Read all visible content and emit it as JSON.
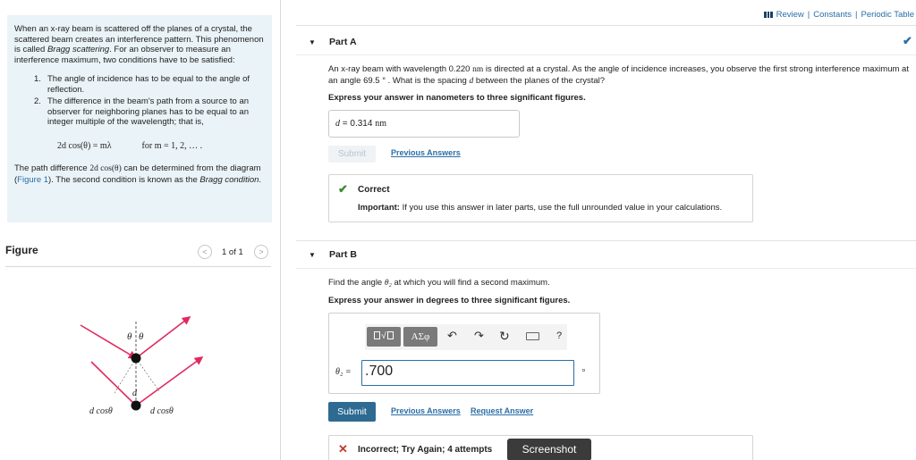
{
  "intro": {
    "para1_before": "When an x-ray beam is scattered off the planes of a crystal, the scattered beam creates an interference pattern. This phenomenon is called ",
    "para1_term": "Bragg scattering",
    "para1_after": ". For an observer to measure an interference maximum, two conditions have to be satisfied:",
    "conditions": [
      {
        "num": "1.",
        "text": "The angle of incidence has to be equal to the angle of reflection."
      },
      {
        "num": "2.",
        "text": "The difference in the beam's path from a source to an observer for neighboring planes has to be equal to an integer multiple of the wavelength; that is,"
      }
    ],
    "equation": "2d cos(θ) = mλ",
    "equation_condition": "for m = 1, 2, … .",
    "path_before": "The path difference ",
    "path_expr": "2d cos(θ)",
    "path_mid": " can be determined from the diagram (",
    "path_link": "Figure 1",
    "path_after": "). The second condition is known as the ",
    "path_term": "Bragg condition",
    "path_end": "."
  },
  "figure": {
    "title": "Figure",
    "pager_text": "1 of 1",
    "prev_glyph": "<",
    "next_glyph": ">",
    "labels": {
      "theta1": "θ",
      "theta2": "θ",
      "d": "d",
      "dcos_left": "d cosθ",
      "dcos_right": "d cosθ"
    },
    "ray_color": "#e0295f"
  },
  "header": {
    "review": "Review",
    "constants": "Constants",
    "periodic": "Periodic Table",
    "separator": "|"
  },
  "partA": {
    "toggle": "▼",
    "title": "Part A",
    "check": "✔",
    "question_before": "An x-ray beam with wavelength 0.220 ",
    "question_unit": "nm",
    "question_mid": " is directed at a crystal. As the angle of incidence increases, you observe the first strong interference maximum at an angle 69.5 ° . What is the spacing ",
    "question_var": "d",
    "question_after": " between the planes of the crystal?",
    "instruction": "Express your answer in nanometers to three significant figures.",
    "answer_var": "d",
    "answer_eq": " = ",
    "answer_value": "0.314",
    "answer_unit": "nm",
    "submit_label": "Submit",
    "previous_answers": "Previous Answers",
    "feedback_icon": "✔",
    "feedback_title": "Correct",
    "feedback_strong": "Important:",
    "feedback_text": " If you use this answer in later parts, use the full unrounded value in your calculations."
  },
  "partB": {
    "toggle": "▼",
    "title": "Part B",
    "question_before": "Find the angle ",
    "question_var": "θ₂",
    "question_after": " at which you will find a second maximum.",
    "instruction": "Express your answer in degrees to three significant figures.",
    "toolbar": {
      "templates_label": "√",
      "symbols_label": "ΑΣφ",
      "undo": "↶",
      "redo": "↷",
      "reset": "↻",
      "help": "?"
    },
    "answer_var": "θ₂ =",
    "answer_value": ".700",
    "submit_label": "Submit",
    "previous_answers": "Previous Answers",
    "request_answer": "Request Answer",
    "feedback_icon": "✕",
    "feedback_title": "Incorrect; Try Again; 4 attempts"
  },
  "overlay": {
    "screenshot_label": "Screenshot"
  }
}
